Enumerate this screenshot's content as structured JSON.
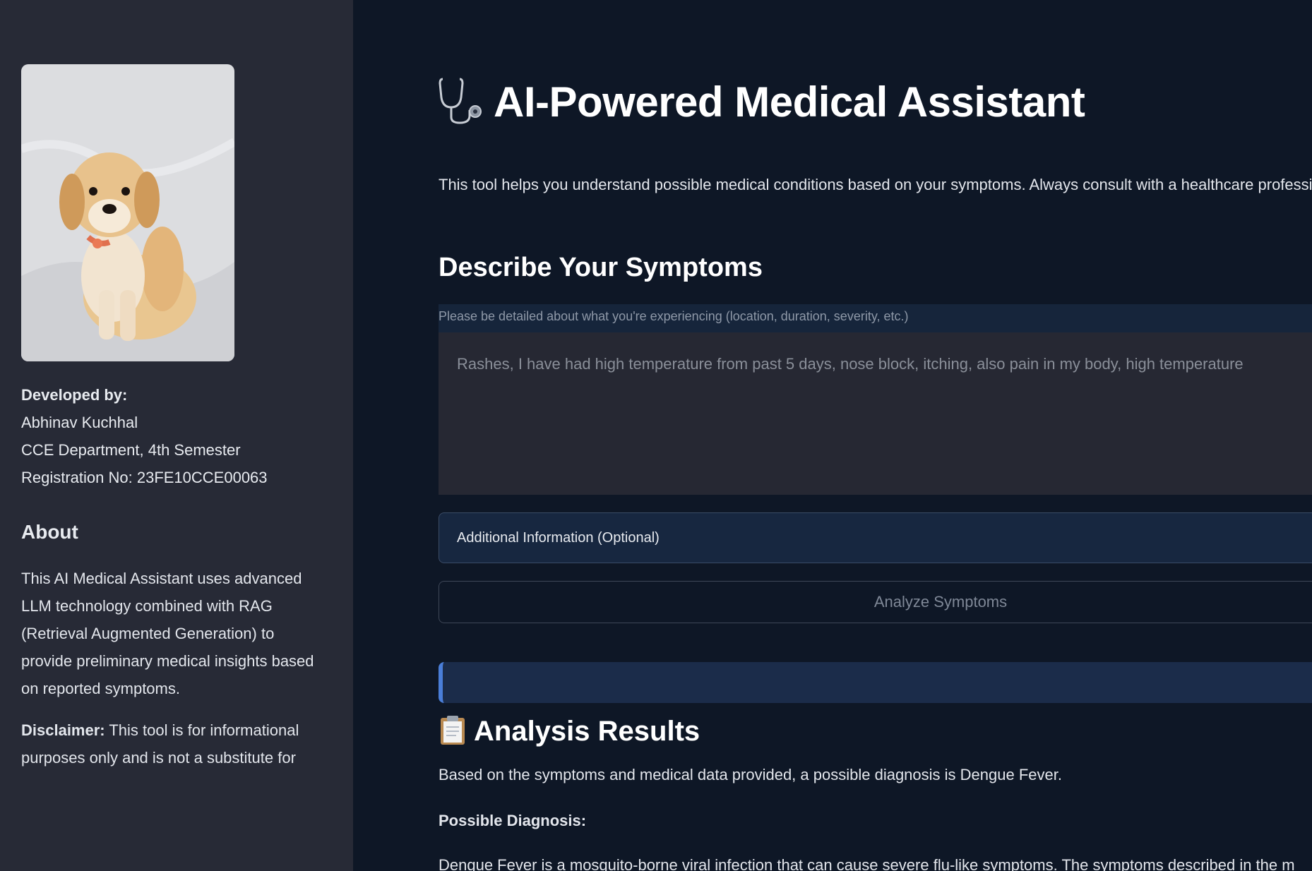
{
  "sidebar": {
    "developed_by_label": "Developed by:",
    "developer_name": "Abhinav Kuchhal",
    "department": "CCE Department, 4th Semester",
    "registration": "Registration No: 23FE10CCE00063",
    "about_title": "About",
    "about_text": "This AI Medical Assistant uses advanced LLM technology combined with RAG (Retrieval Augmented Generation) to provide preliminary medical insights based on reported symptoms.",
    "disclaimer_label": "Disclaimer:",
    "disclaimer_text": " This tool is for informational purposes only and is not a substitute for"
  },
  "main": {
    "title_icon": "stethoscope-icon",
    "title": "AI-Powered Medical Assistant",
    "intro": "This tool helps you understand possible medical conditions based on your symptoms. Always consult with a healthcare professional for proper diagnosis and treatment.",
    "symptoms_heading": "Describe Your Symptoms",
    "symptoms_hint": "Please be detailed about what you're experiencing (location, duration, severity, etc.)",
    "symptoms_value": "Rashes, I have had high temperature from past 5 days, nose block, itching, also pain in my body, high temperature",
    "additional_info_label": "Additional Information (Optional)",
    "analyze_button": "Analyze Symptoms",
    "results_icon": "clipboard-icon",
    "results_heading": "Analysis Results",
    "results_text": "Based on the symptoms and medical data provided, a possible diagnosis is Dengue Fever.",
    "diagnosis_label": "Possible Diagnosis:",
    "diagnosis_desc": "Dengue Fever is a mosquito-borne viral infection that can cause severe flu-like symptoms. The symptoms described in the m"
  },
  "colors": {
    "sidebar_bg": "#272a36",
    "main_bg": "#0e1726",
    "accent": "#4a7ed8"
  }
}
